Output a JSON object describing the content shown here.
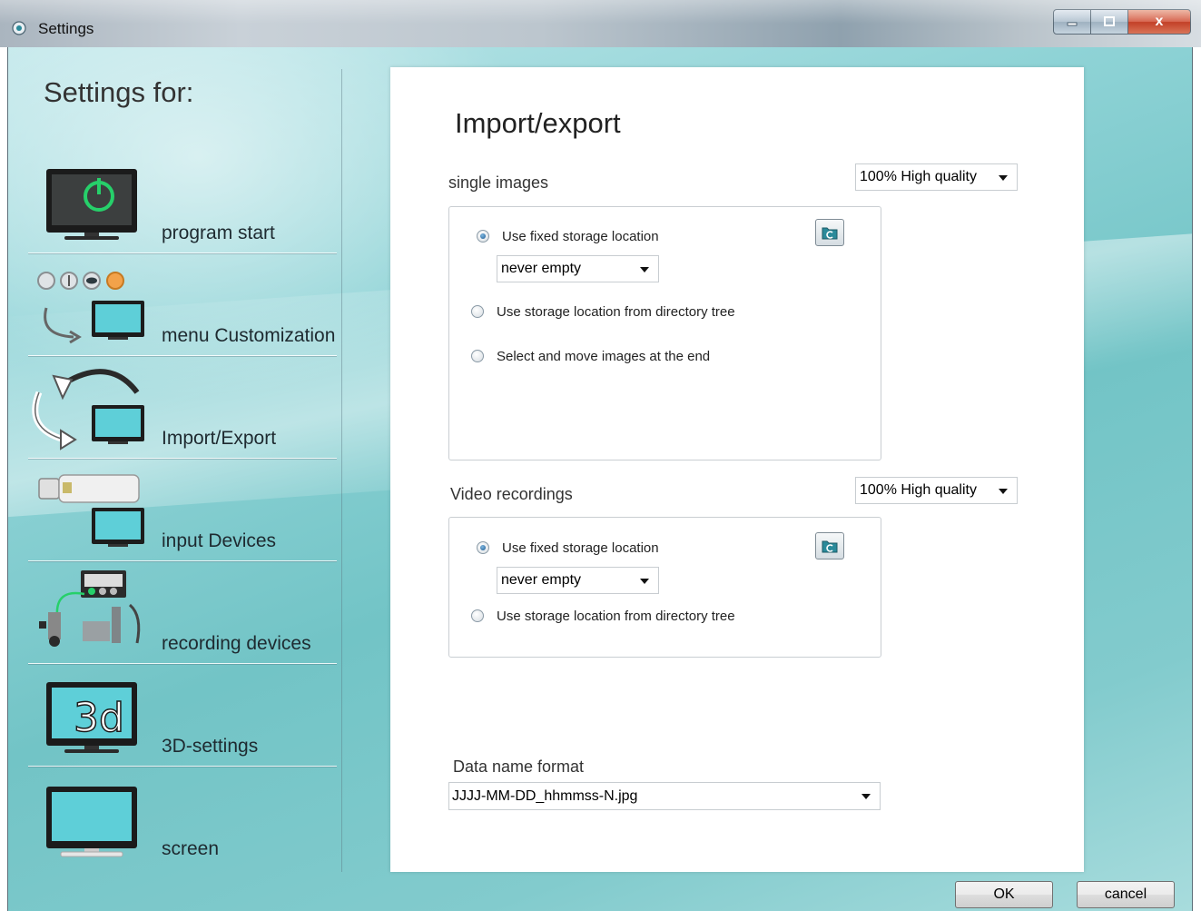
{
  "window": {
    "title": "Settings",
    "close_glyph": "x"
  },
  "nav": {
    "heading": "Settings for:",
    "items": [
      {
        "label": "program start",
        "icon": "power-monitor-icon"
      },
      {
        "label": "menu Customization",
        "icon": "menu-customization-icon"
      },
      {
        "label": "Import/Export",
        "icon": "import-export-icon"
      },
      {
        "label": "input Devices",
        "icon": "usb-device-icon"
      },
      {
        "label": "recording devices",
        "icon": "recording-devices-icon"
      },
      {
        "label": "3D-settings",
        "icon": "3d-monitor-icon"
      },
      {
        "label": "screen",
        "icon": "screen-monitor-icon"
      }
    ],
    "selected": "Import/Export"
  },
  "panel": {
    "title": "Import/export",
    "single_images": {
      "label": "single images",
      "quality": "100% High quality",
      "options": [
        {
          "label": "Use fixed storage location",
          "checked": true
        },
        {
          "label": "Use storage location from directory tree",
          "checked": false
        },
        {
          "label": "Select and move images at the end",
          "checked": false
        }
      ],
      "fixed_mode": "never empty"
    },
    "video_recordings": {
      "label": "Video recordings",
      "quality": "100% High quality",
      "options": [
        {
          "label": "Use fixed storage location",
          "checked": true
        },
        {
          "label": "Use storage location from directory tree",
          "checked": false
        }
      ],
      "fixed_mode": "never empty"
    },
    "data_name_format": {
      "label": "Data name format",
      "value": "JJJJ-MM-DD_hhmmss-N.jpg"
    }
  },
  "buttons": {
    "ok": "OK",
    "cancel": "cancel"
  },
  "colors": {
    "background_teal": "#7fcbcd",
    "panel": "#ffffff",
    "radio_checked": "#1c5a92",
    "close_button": "#c23f26"
  }
}
